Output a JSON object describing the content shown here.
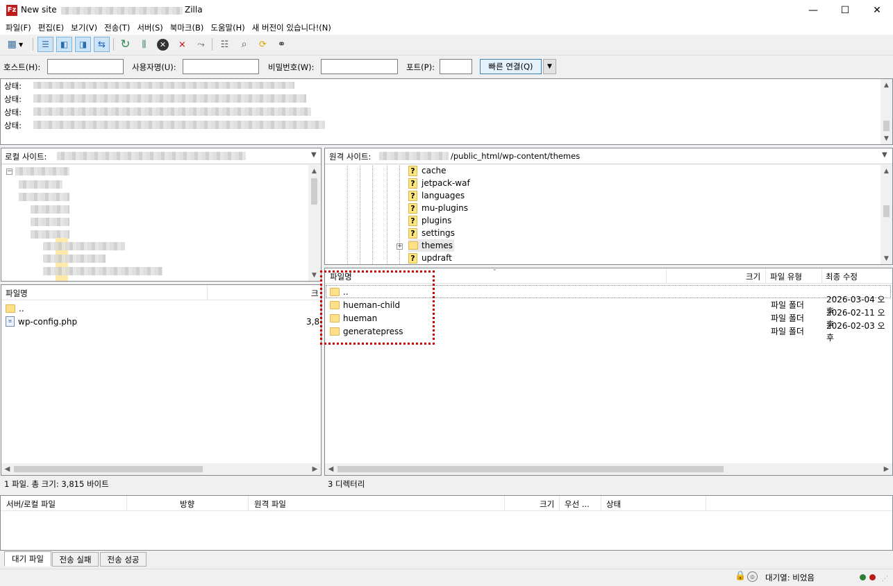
{
  "window": {
    "title_prefix": "New site",
    "title_suffix": "Zilla",
    "minimize": "—",
    "maximize": "☐",
    "close": "✕"
  },
  "menu": [
    "파일(F)",
    "편집(E)",
    "보기(V)",
    "전송(T)",
    "서버(S)",
    "북마크(B)",
    "도움말(H)",
    "새 버전이 있습니다!(N)"
  ],
  "quickconnect": {
    "host_label": "호스트(H):",
    "user_label": "사용자명(U):",
    "pass_label": "비밀번호(W):",
    "port_label": "포트(P):",
    "connect_label": "빠른 연결(Q)",
    "host_value": "",
    "user_value": "",
    "pass_value": "",
    "port_value": ""
  },
  "log": {
    "prefix": "상태:",
    "line_count": 4
  },
  "local": {
    "site_label": "로컬 사이트:",
    "col_name": "파일명",
    "col_size_partial": "크",
    "files": [
      {
        "name": "..",
        "size": ""
      },
      {
        "name": "wp-config.php",
        "size": "3,8"
      }
    ],
    "status": "1 파일. 총 크기: 3,815 바이트"
  },
  "remote": {
    "site_label": "원격 사이트:",
    "path": "/public_html/wp-content/themes",
    "tree": [
      {
        "name": "cache",
        "icon": "question"
      },
      {
        "name": "jetpack-waf",
        "icon": "question"
      },
      {
        "name": "languages",
        "icon": "question"
      },
      {
        "name": "mu-plugins",
        "icon": "question"
      },
      {
        "name": "plugins",
        "icon": "question"
      },
      {
        "name": "settings",
        "icon": "question"
      },
      {
        "name": "themes",
        "icon": "folder"
      },
      {
        "name": "updraft",
        "icon": "question"
      }
    ],
    "columns": {
      "name": "파일명",
      "size": "크기",
      "type": "파일 유형",
      "modified": "최종 수정"
    },
    "files": [
      {
        "name": "..",
        "size": "",
        "type": "",
        "modified": ""
      },
      {
        "name": "hueman-child",
        "size": "",
        "type": "파일 폴더",
        "modified": "2026-03-04 오후"
      },
      {
        "name": "hueman",
        "size": "",
        "type": "파일 폴더",
        "modified": "2026-02-11 오후"
      },
      {
        "name": "generatepress",
        "size": "",
        "type": "파일 폴더",
        "modified": "2026-02-03 오후"
      }
    ],
    "status": "3 디렉터리"
  },
  "queue": {
    "columns": {
      "local": "서버/로컬 파일",
      "direction": "방향",
      "remote": "원격 파일",
      "size": "크기",
      "priority": "우선 ...",
      "status": "상태"
    },
    "tabs": [
      "대기 파일",
      "전송 실패",
      "전송 성공"
    ]
  },
  "statusbar": {
    "queue_text": "대기열: 비었음"
  },
  "colors": {
    "highlight": "#cc0000",
    "folder": "#ffe08a",
    "question_icon": "#ffe680"
  }
}
